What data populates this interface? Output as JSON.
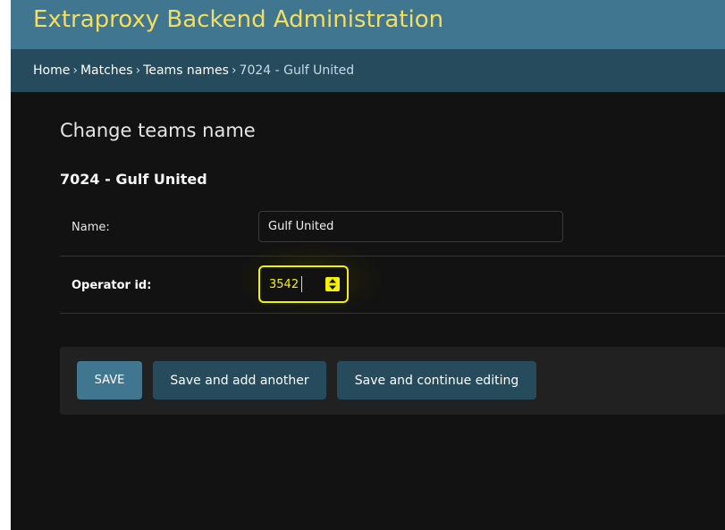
{
  "header": {
    "site_title": "Extraproxy Backend Administration"
  },
  "breadcrumbs": {
    "items": [
      "Home",
      "Matches",
      "Teams names"
    ],
    "separator": "›",
    "current": "7024 - Gulf United"
  },
  "page": {
    "title": "Change teams name",
    "object_title": "7024 - Gulf United"
  },
  "form": {
    "name_label": "Name:",
    "name_value": "Gulf United",
    "operator_label": "Operator id:",
    "operator_value": "3542"
  },
  "actions": {
    "save_label": "SAVE",
    "save_add_label": "Save and add another",
    "save_continue_label": "Save and continue editing"
  },
  "colors": {
    "header_bg": "#417690",
    "breadcrumbs_bg": "#264b5d",
    "title_yellow": "#f5dd5d",
    "focus_yellow": "#f5f100",
    "page_bg": "#121212"
  }
}
